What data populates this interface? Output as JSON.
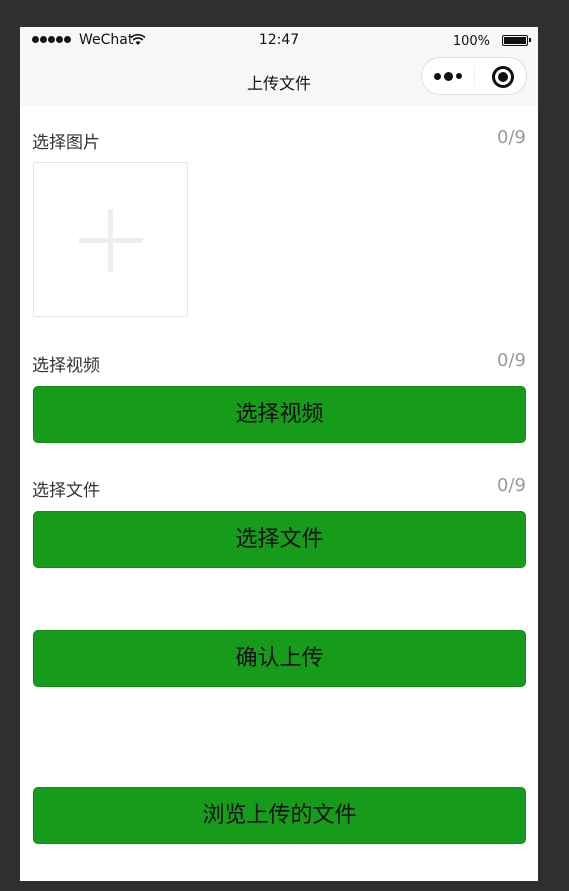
{
  "status_bar": {
    "carrier": "WeChat",
    "time": "12:47",
    "battery": "100%"
  },
  "nav": {
    "title": "上传文件",
    "more_icon": "more-dots-icon",
    "close_icon": "capsule-close-icon"
  },
  "sections": {
    "image": {
      "label": "选择图片",
      "count": "0/9",
      "add_icon": "plus-icon"
    },
    "video": {
      "label": "选择视频",
      "count": "0/9",
      "button": "选择视频"
    },
    "file": {
      "label": "选择文件",
      "count": "0/9",
      "button": "选择文件"
    }
  },
  "actions": {
    "confirm": "确认上传",
    "browse": "浏览上传的文件"
  },
  "colors": {
    "button_green": "#179b1b",
    "background": "#2f2f2f",
    "nav_bg": "#f7f7f7"
  }
}
